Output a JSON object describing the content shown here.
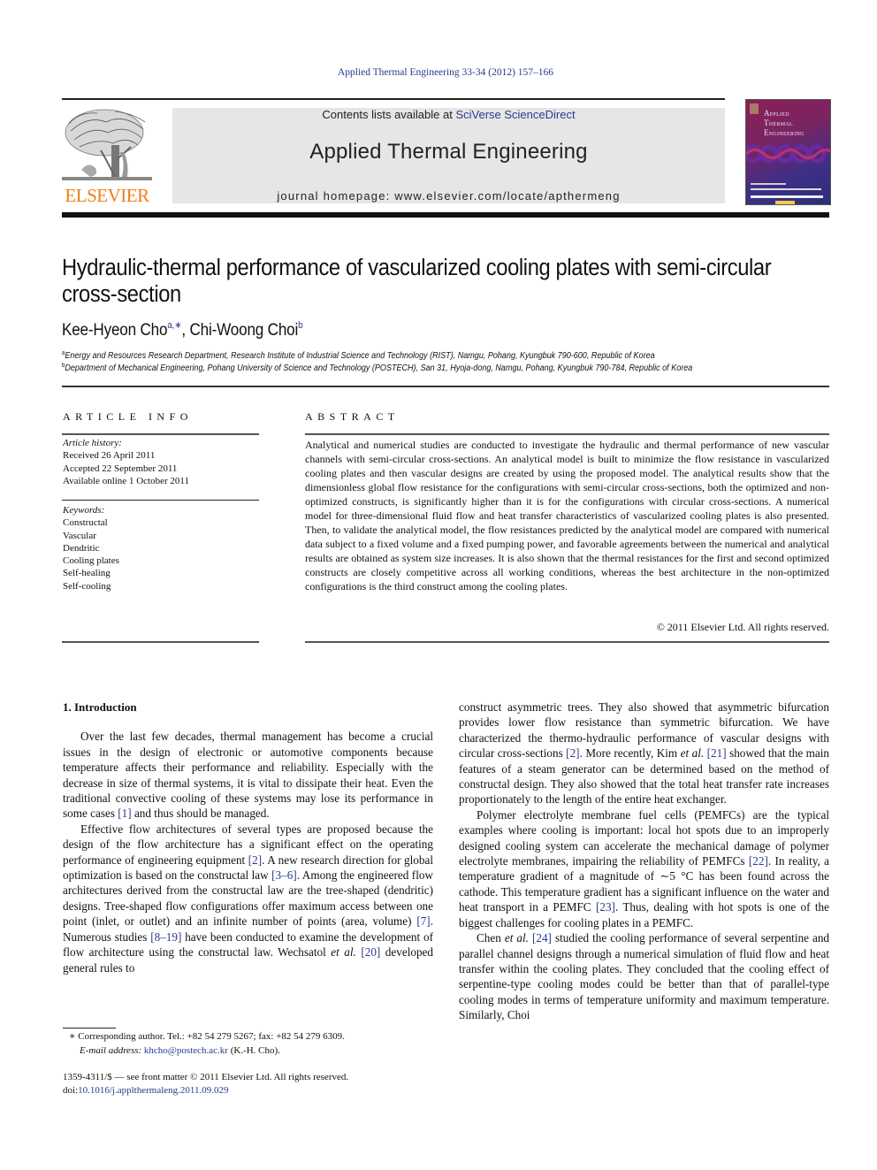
{
  "journal_citation": "Applied Thermal Engineering 33-34 (2012) 157–166",
  "header": {
    "publisher_logo_text": "ELSEVIER",
    "contents_prefix": "Contents lists available at ",
    "contents_link": "SciVerse ScienceDirect",
    "journal_name": "Applied Thermal Engineering",
    "homepage_line": "journal homepage: www.elsevier.com/locate/apthermeng",
    "cover_title": "Applied\nThermal\nEngineering"
  },
  "colors": {
    "link": "#2b3a8c",
    "elsevier_orange": "#f07d15",
    "header_box": "#e6e6e6"
  },
  "article": {
    "title": "Hydraulic-thermal performance of vascularized cooling plates with semi-circular cross-section",
    "authors": [
      {
        "name": "Kee-Hyeon Cho",
        "marks": "a,∗"
      },
      {
        "name": "Chi-Woong Choi",
        "marks": "b"
      }
    ],
    "author_separator": ", ",
    "affiliations": [
      {
        "mark": "a",
        "text": "Energy and Resources Research Department, Research Institute of Industrial Science and Technology (RIST), Namgu, Pohang, Kyungbuk 790-600, Republic of Korea"
      },
      {
        "mark": "b",
        "text": "Department of Mechanical Engineering, Pohang University of Science and Technology (POSTECH), San 31, Hyoja-dong, Namgu, Pohang, Kyungbuk 790-784, Republic of Korea"
      }
    ]
  },
  "article_info": {
    "heading": "ARTICLE INFO",
    "history_label": "Article history:",
    "history": [
      "Received 26 April 2011",
      "Accepted 22 September 2011",
      "Available online 1 October 2011"
    ],
    "keywords_label": "Keywords:",
    "keywords": [
      "Constructal",
      "Vascular",
      "Dendritic",
      "Cooling plates",
      "Self-healing",
      "Self-cooling"
    ]
  },
  "abstract": {
    "heading": "ABSTRACT",
    "text": "Analytical and numerical studies are conducted to investigate the hydraulic and thermal performance of new vascular channels with semi-circular cross-sections. An analytical model is built to minimize the flow resistance in vascularized cooling plates and then vascular designs are created by using the proposed model. The analytical results show that the dimensionless global flow resistance for the configurations with semi-circular cross-sections, both the optimized and non-optimized constructs, is significantly higher than it is for the configurations with circular cross-sections. A numerical model for three-dimensional fluid flow and heat transfer characteristics of vascularized cooling plates is also presented. Then, to validate the analytical model, the flow resistances predicted by the analytical model are compared with numerical data subject to a fixed volume and a fixed pumping power, and favorable agreements between the numerical and analytical results are obtained as system size increases. It is also shown that the thermal resistances for the first and second optimized constructs are closely competitive across all working conditions, whereas the best architecture in the non-optimized configurations is the third construct among the cooling plates.",
    "copyright": "© 2011 Elsevier Ltd. All rights reserved."
  },
  "body": {
    "intro_heading": "1.  Introduction",
    "left_paragraphs": [
      [
        {
          "t": "Over the last few decades, thermal management has become a crucial issues in the design of electronic or automotive components because temperature affects their performance and reliability. Especially with the decrease in size of thermal systems, it is vital to dissipate their heat. Even the traditional convective cooling of these systems may lose its performance in some cases "
        },
        {
          "ref": "[1]"
        },
        {
          "t": " and thus should be managed."
        }
      ],
      [
        {
          "t": "Effective flow architectures of several types are proposed because the design of the flow architecture has a significant effect on the operating performance of engineering equipment "
        },
        {
          "ref": "[2]"
        },
        {
          "t": ". A new research direction for global optimization is based on the constructal law "
        },
        {
          "ref": "[3–6]"
        },
        {
          "t": ". Among the engineered flow architectures derived from the constructal law are the tree-shaped (dendritic) designs. Tree-shaped flow configurations offer maximum access between one point (inlet, or outlet) and an infinite number of points (area, volume) "
        },
        {
          "ref": "[7]"
        },
        {
          "t": ". Numerous studies "
        },
        {
          "ref": "[8–19]"
        },
        {
          "t": " have been conducted to examine the development of flow architecture using the constructal law. Wechsatol "
        },
        {
          "i": "et al."
        },
        {
          "t": " "
        },
        {
          "ref": "[20]"
        },
        {
          "t": " developed general rules to"
        }
      ]
    ],
    "right_paragraphs": [
      [
        {
          "t": "construct asymmetric trees. They also showed that asymmetric bifurcation provides lower flow resistance than symmetric bifurcation. We have characterized the thermo-hydraulic performance of vascular designs with circular cross-sections "
        },
        {
          "ref": "[2]"
        },
        {
          "t": ". More recently, Kim "
        },
        {
          "i": "et al."
        },
        {
          "t": " "
        },
        {
          "ref": "[21]"
        },
        {
          "t": " showed that the main features of a steam generator can be determined based on the method of constructal design. They also showed that the total heat transfer rate increases proportionately to the length of the entire heat exchanger."
        }
      ],
      [
        {
          "t": "Polymer electrolyte membrane fuel cells (PEMFCs) are the typical examples where cooling is important: local hot spots due to an improperly designed cooling system can accelerate the mechanical damage of polymer electrolyte membranes, impairing the reliability of PEMFCs "
        },
        {
          "ref": "[22]"
        },
        {
          "t": ". In reality, a temperature gradient of a magnitude of ∼5 °C has been found across the cathode. This temperature gradient has a significant influence on the water and heat transport in a PEMFC "
        },
        {
          "ref": "[23]"
        },
        {
          "t": ". Thus, dealing with hot spots is one of the biggest challenges for cooling plates in a PEMFC."
        }
      ],
      [
        {
          "t": "Chen "
        },
        {
          "i": "et al."
        },
        {
          "t": " "
        },
        {
          "ref": "[24]"
        },
        {
          "t": " studied the cooling performance of several serpentine and parallel channel designs through a numerical simulation of fluid flow and heat transfer within the cooling plates. They concluded that the cooling effect of serpentine-type cooling modes could be better than that of parallel-type cooling modes in terms of temperature uniformity and maximum temperature. Similarly, Choi"
        }
      ]
    ]
  },
  "footnotes": {
    "corresponding": "∗  Corresponding author. Tel.: +82 54 279 5267; fax: +82 54 279 6309.",
    "email_label": "E-mail address:",
    "email": "khcho@postech.ac.kr",
    "email_suffix": " (K.-H. Cho).",
    "front_matter": "1359-4311/$ — see front matter © 2011 Elsevier Ltd. All rights reserved.",
    "doi_label": "doi:",
    "doi": "10.1016/j.applthermaleng.2011.09.029"
  }
}
